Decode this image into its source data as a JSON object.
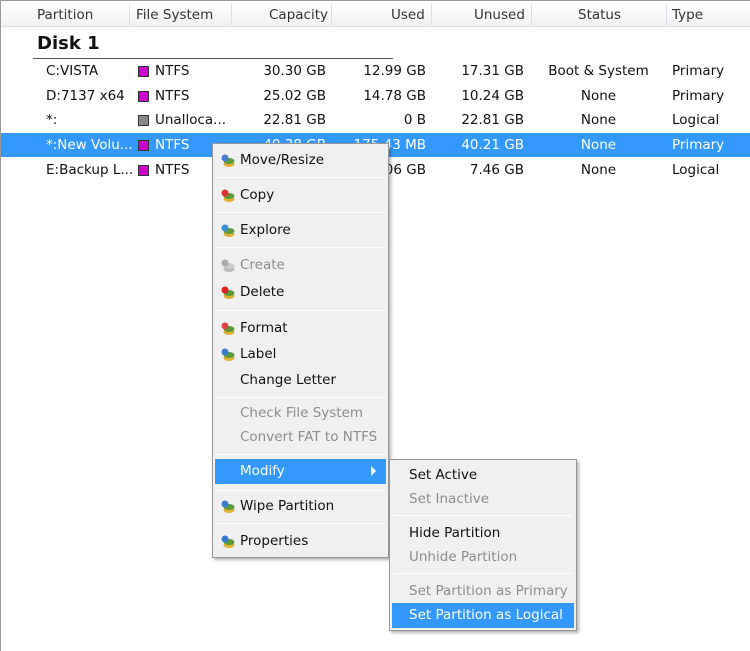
{
  "columns": [
    "Partition",
    "File System",
    "Capacity",
    "Used",
    "Unused",
    "Status",
    "Type"
  ],
  "disk_label": "Disk 1",
  "rows": [
    {
      "partition": "C:VISTA",
      "fs": "NTFS",
      "fs_color": "#cc00cc",
      "capacity": "30.30 GB",
      "used": "12.99 GB",
      "unused": "17.31 GB",
      "status": "Boot & System",
      "type": "Primary"
    },
    {
      "partition": "D:7137 x64",
      "fs": "NTFS",
      "fs_color": "#cc00cc",
      "capacity": "25.02 GB",
      "used": "14.78 GB",
      "unused": "10.24 GB",
      "status": "None",
      "type": "Primary"
    },
    {
      "partition": "*:",
      "fs": "Unalloca...",
      "fs_color": "#888888",
      "capacity": "22.81 GB",
      "used": "0 B",
      "unused": "22.81 GB",
      "status": "None",
      "type": "Logical"
    },
    {
      "partition": "*:New Volu...",
      "fs": "NTFS",
      "fs_color": "#cc00cc",
      "capacity": "40.38 GB",
      "used": "175.43 MB",
      "unused": "40.21 GB",
      "status": "None",
      "type": "Primary",
      "selected": true
    },
    {
      "partition": "E:Backup L...",
      "fs": "NTFS",
      "fs_color": "#cc00cc",
      "capacity": "",
      "used": "06 GB",
      "unused": "7.46 GB",
      "status": "None",
      "type": "Logical"
    }
  ],
  "context_menu": [
    {
      "label": "Move/Resize",
      "icon": "move-resize-icon"
    },
    {
      "label": "Copy",
      "icon": "copy-icon"
    },
    {
      "label": "Explore",
      "icon": "explore-icon"
    },
    {
      "label": "Create",
      "icon": "create-icon",
      "disabled": true
    },
    {
      "label": "Delete",
      "icon": "delete-icon"
    },
    {
      "label": "Format",
      "icon": "format-icon"
    },
    {
      "label": "Label",
      "icon": "label-icon"
    },
    {
      "label": "Change Letter"
    },
    {
      "label": "Check File System",
      "disabled": true
    },
    {
      "label": "Convert FAT to NTFS",
      "disabled": true
    },
    {
      "label": "Modify",
      "submenu": true,
      "highlighted": true
    },
    {
      "label": "Wipe Partition",
      "icon": "wipe-icon"
    },
    {
      "label": "Properties",
      "icon": "properties-icon"
    }
  ],
  "submenu": [
    {
      "label": "Set Active"
    },
    {
      "label": "Set Inactive",
      "disabled": true
    },
    {
      "label": "Hide Partition"
    },
    {
      "label": "Unhide Partition",
      "disabled": true
    },
    {
      "label": "Set Partition as Primary",
      "disabled": true
    },
    {
      "label": "Set Partition as Logical",
      "highlighted": true
    }
  ],
  "colors": {
    "selection": "#3399ff",
    "ntfs": "#cc00cc",
    "unallocated": "#888888"
  }
}
